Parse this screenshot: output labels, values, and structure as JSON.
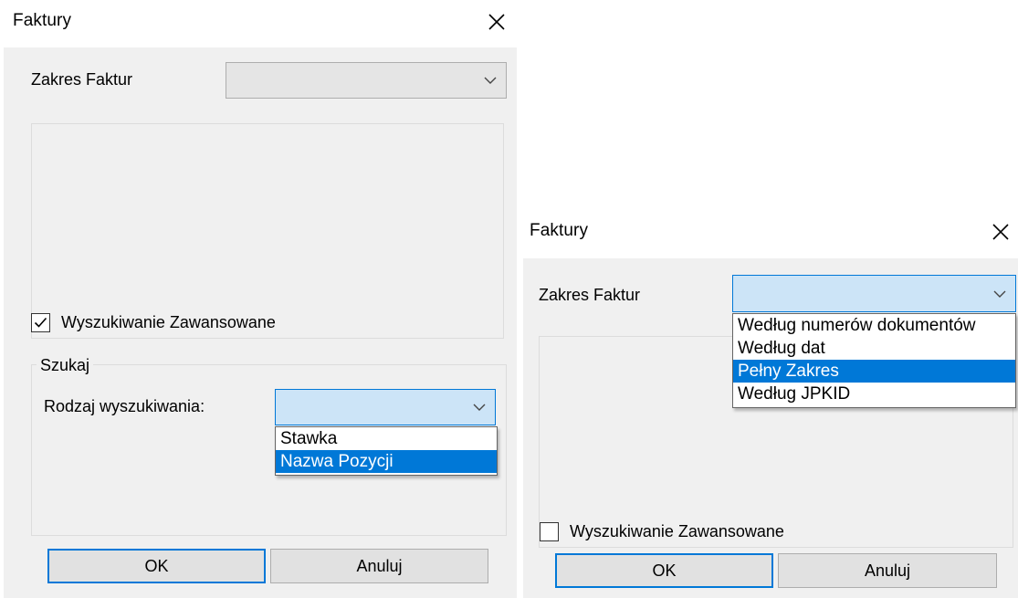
{
  "left_dialog": {
    "title": "Faktury",
    "zakres_label": "Zakres Faktur",
    "zakres_value": "",
    "advanced_label": "Wyszukiwanie Zawansowane",
    "advanced_checked": true,
    "group_title": "Szukaj",
    "rodzaj_label": "Rodzaj wyszukiwania:",
    "rodzaj_value": "",
    "rodzaj_options": [
      {
        "label": "Stawka",
        "selected": false
      },
      {
        "label": "Nazwa Pozycji",
        "selected": true
      }
    ],
    "ok_label": "OK",
    "cancel_label": "Anuluj"
  },
  "right_dialog": {
    "title": "Faktury",
    "zakres_label": "Zakres Faktur",
    "zakres_value": "",
    "zakres_options": [
      {
        "label": "Według numerów dokumentów",
        "selected": false
      },
      {
        "label": "Według dat",
        "selected": false
      },
      {
        "label": "Pełny Zakres",
        "selected": true
      },
      {
        "label": "Według JPKID",
        "selected": false
      }
    ],
    "advanced_label": "Wyszukiwanie Zawansowane",
    "advanced_checked": false,
    "ok_label": "OK",
    "cancel_label": "Anuluj"
  },
  "colors": {
    "accent": "#0078d7",
    "dialog_background": "#f0f0f0",
    "combo_focus_background": "#cce4f7",
    "button_background": "#e1e1e1"
  },
  "icons": {
    "close": "close-icon",
    "dropdown_arrow": "chevron-down-icon",
    "checkmark": "checkmark-icon"
  }
}
